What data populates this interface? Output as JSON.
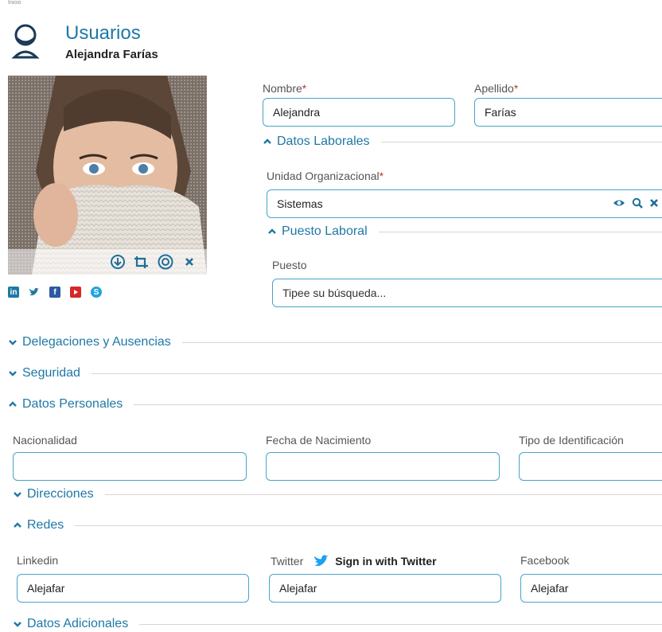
{
  "breadcrumb": "Inicio",
  "header": {
    "title": "Usuarios",
    "subtitle": "Alejandra Farías",
    "icon": "user-outline-icon"
  },
  "colors": {
    "accent": "#1e78a6",
    "field_border": "#4aa3c9",
    "required": "#c0392b"
  },
  "photo_toolbar": [
    "download-icon",
    "crop-icon",
    "view-icon",
    "remove-icon"
  ],
  "social_icons": [
    "linkedin-icon",
    "twitter-icon",
    "facebook-icon",
    "youtube-icon",
    "skype-icon"
  ],
  "form": {
    "nombre": {
      "label": "Nombre",
      "required": "*",
      "value": "Alejandra"
    },
    "apellido": {
      "label": "Apellido",
      "required": "*",
      "value": "Farías"
    },
    "datos_laborales": {
      "title": "Datos Laborales",
      "state": "expanded"
    },
    "unidad_org": {
      "label": "Unidad Organizacional",
      "required": "*",
      "value": "Sistemas",
      "icons": [
        "eye-icon",
        "search-icon",
        "clear-icon"
      ]
    },
    "puesto_laboral": {
      "title": "Puesto Laboral",
      "state": "expanded"
    },
    "puesto": {
      "label": "Puesto",
      "placeholder": "Tipee su búsqueda..."
    }
  },
  "sections": {
    "delegaciones": {
      "title": "Delegaciones y Ausencias",
      "state": "collapsed"
    },
    "seguridad": {
      "title": "Seguridad",
      "state": "collapsed"
    },
    "datos_personales": {
      "title": "Datos Personales",
      "state": "expanded"
    },
    "direcciones": {
      "title": "Direcciones",
      "state": "collapsed"
    },
    "redes": {
      "title": "Redes",
      "state": "expanded"
    },
    "datos_adicionales": {
      "title": "Datos Adicionales",
      "state": "collapsed"
    }
  },
  "personal": {
    "nacionalidad": {
      "label": "Nacionalidad",
      "value": ""
    },
    "fecha_nacimiento": {
      "label": "Fecha de Nacimiento",
      "value": ""
    },
    "tipo_identificacion": {
      "label": "Tipo de Identificación",
      "value": ""
    }
  },
  "redes": {
    "linkedin": {
      "label": "Linkedin",
      "value": "Alejafar"
    },
    "twitter": {
      "label": "Twitter",
      "signin": "Sign in with Twitter",
      "value": "Alejafar"
    },
    "facebook": {
      "label": "Facebook",
      "value": "Alejafar"
    }
  }
}
